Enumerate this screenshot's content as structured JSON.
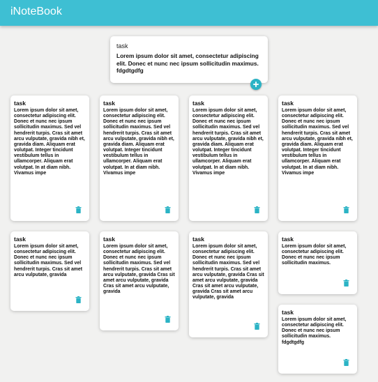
{
  "header": {
    "app_title": "iNoteBook"
  },
  "create_note": {
    "title": "task",
    "content": "Lorem ipsum dolor sit amet, consectetur adipiscing elit. Donec et nunc nec ipsum sollicitudin maximus. fdgdtgdfg"
  },
  "notes": [
    {
      "title": "task",
      "content": "Lorem ipsum dolor sit amet, consectetur adipiscing elit. Donec et nunc nec ipsum sollicitudin maximus. Sed vel hendrerit turpis. Cras sit amet arcu vulputate, gravida nibh et, gravida diam. Aliquam erat volutpat. Integer tincidunt vestibulum tellus in ullamcorper. Aliquam erat volutpat. In at diam nibh. Vivamus impe"
    },
    {
      "title": "task",
      "content": "Lorem ipsum dolor sit amet, consectetur adipiscing elit. Donec et nunc nec ipsum sollicitudin maximus. Sed vel hendrerit turpis. Cras sit amet arcu vulputate, gravida nibh et, gravida diam. Aliquam erat volutpat. Integer tincidunt vestibulum tellus in ullamcorper. Aliquam erat volutpat. In at diam nibh. Vivamus impe"
    },
    {
      "title": "task",
      "content": "Lorem ipsum dolor sit amet, consectetur adipiscing elit. Donec et nunc nec ipsum sollicitudin maximus. Sed vel hendrerit turpis. Cras sit amet arcu vulputate, gravida nibh et, gravida diam. Aliquam erat volutpat. Integer tincidunt vestibulum tellus in ullamcorper. Aliquam erat volutpat. In at diam nibh. Vivamus impe"
    },
    {
      "title": "task",
      "content": "Lorem ipsum dolor sit amet, consectetur adipiscing elit. Donec et nunc nec ipsum sollicitudin maximus. Sed vel hendrerit turpis. Cras sit amet arcu vulputate, gravida nibh et, gravida diam. Aliquam erat volutpat. Integer tincidunt vestibulum tellus in ullamcorper. Aliquam erat volutpat. In at diam nibh. Vivamus impe"
    },
    {
      "title": "task",
      "content": "Lorem ipsum dolor sit amet, consectetur adipiscing elit. Donec et nunc nec ipsum sollicitudin maximus. Sed vel hendrerit turpis. Cras sit amet arcu vulputate, gravida"
    },
    {
      "title": "task",
      "content": "Lorem ipsum dolor sit amet, consectetur adipiscing elit. Donec et nunc nec ipsum sollicitudin maximus. Sed vel hendrerit turpis. Cras sit amet arcu vulputate, gravida Cras sit amet arcu vulputate, gravida Cras sit amet arcu vulputate, gravida"
    },
    {
      "title": "task",
      "content": "Lorem ipsum dolor sit amet, consectetur adipiscing elit. Donec et nunc nec ipsum sollicitudin maximus. Sed vel hendrerit turpis. Cras sit amet arcu vulputate, gravida Cras sit amet arcu vulputate, gravida Cras sit amet arcu vulputate, gravida Cras sit amet arcu vulputate, gravida"
    },
    {
      "title": "task",
      "content": "Lorem ipsum dolor sit amet, consectetur adipiscing elit. Donec et nunc nec ipsum sollicitudin maximus."
    },
    {
      "title": "task",
      "content": "Lorem ipsum dolor sit amet, consectetur adipiscing elit. Donec et nunc nec ipsum sollicitudin maximus. fdgdtgdfg"
    }
  ],
  "colors": {
    "header_bg": "#3ebfd3",
    "accent": "#2bb3c5",
    "background": "#f1f1f0"
  },
  "icons": {
    "add": "plus-icon",
    "delete": "trash-icon"
  }
}
